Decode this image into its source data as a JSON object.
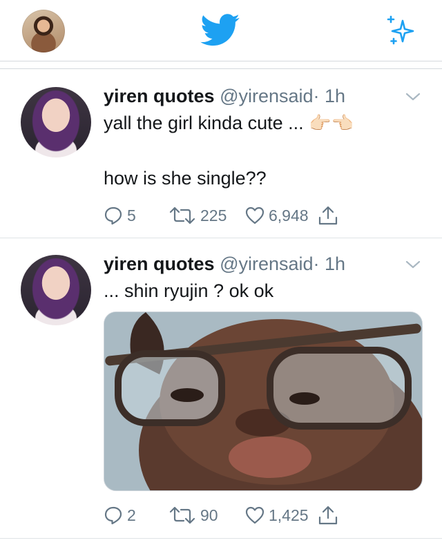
{
  "header": {
    "bird_icon": "twitter-bird-icon",
    "sparkle_icon": "sparkle-icon",
    "brand_color": "#1da1f2"
  },
  "tweets": [
    {
      "name": "yiren quotes",
      "handle": "@yirensaid",
      "time": "· 1h",
      "line1": "yall the girl kinda cute ...",
      "emoji": "👉🏻👈🏻",
      "line2": "how is she single??",
      "replies": "5",
      "retweets": "225",
      "likes": "6,948"
    },
    {
      "name": "yiren quotes",
      "handle": "@yirensaid",
      "time": "· 1h",
      "line1": "... shin ryujin ? ok ok",
      "replies": "2",
      "retweets": "90",
      "likes": "1,425"
    }
  ]
}
